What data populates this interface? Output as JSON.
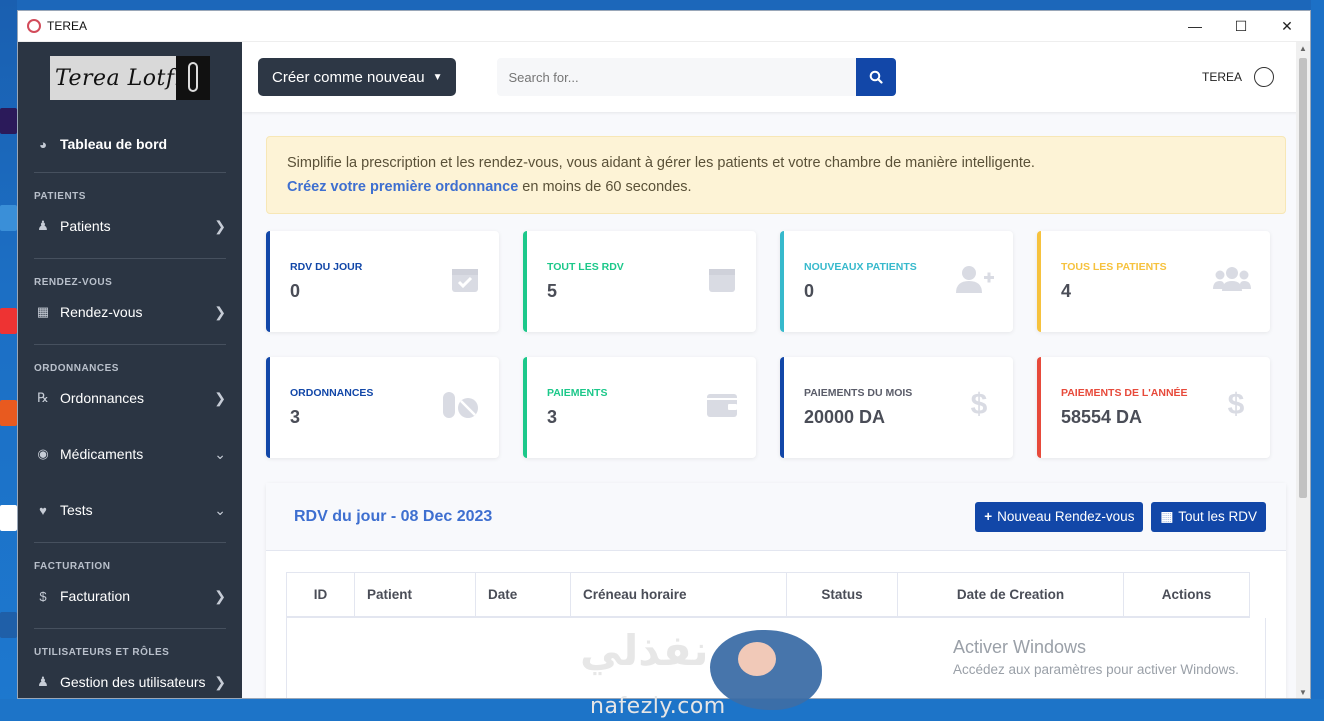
{
  "window": {
    "title": "TEREA",
    "controls": [
      "minimize",
      "maximize",
      "close"
    ]
  },
  "sidebar": {
    "logo_text": "Terea Lotfi",
    "dashboard": {
      "label": "Tableau de bord",
      "icon": "tachometer-icon"
    },
    "sections": [
      {
        "title": "PATIENTS",
        "items": [
          {
            "label": "Patients",
            "icon": "user-icon"
          }
        ]
      },
      {
        "title": "RENDEZ-VOUS",
        "items": [
          {
            "label": "Rendez-vous",
            "icon": "calendar-icon"
          }
        ]
      },
      {
        "title": "ORDONNANCES",
        "items": [
          {
            "label": "Ordonnances",
            "icon": "prescription-icon"
          },
          {
            "label": "Médicaments",
            "icon": "pills-icon"
          },
          {
            "label": "Tests",
            "icon": "heart-icon"
          }
        ]
      },
      {
        "title": "FACTURATION",
        "items": [
          {
            "label": "Facturation",
            "icon": "dollar-icon"
          }
        ]
      },
      {
        "title": "UTILISATEURS ET RÔLES",
        "items": [
          {
            "label": "Gestion des utilisateurs",
            "icon": "users-icon"
          }
        ]
      }
    ]
  },
  "topbar": {
    "create_label": "Créer comme nouveau",
    "search_placeholder": "Search for...",
    "user_name": "TEREA"
  },
  "alert": {
    "line1": "Simplifie la prescription et les rendez-vous, vous aidant à gérer les patients et votre chambre de manière intelligente.",
    "link": "Créez votre première ordonnance",
    "line2_rest": " en moins de 60 secondes."
  },
  "cards": [
    {
      "label": "RDV DU JOUR",
      "value": "0",
      "color": "#1247a8",
      "icon": "calendar-check-icon"
    },
    {
      "label": "TOUT LES RDV",
      "value": "5",
      "color": "#1cc88a",
      "icon": "calendar-icon"
    },
    {
      "label": "NOUVEAUX PATIENTS",
      "value": "0",
      "color": "#36b9cc",
      "icon": "user-plus-icon"
    },
    {
      "label": "TOUS LES PATIENTS",
      "value": "4",
      "color": "#f6c23e",
      "icon": "users-icon"
    },
    {
      "label": "ORDONNANCES",
      "value": "3",
      "color": "#1247a8",
      "icon": "pills-icon"
    },
    {
      "label": "PAIEMENTS",
      "value": "3",
      "color": "#1cc88a",
      "icon": "wallet-icon"
    },
    {
      "label": "PAIEMENTS DU MOIS",
      "value": "20000 DA",
      "color": "#1247a8",
      "label_color": "#5a5c69",
      "icon": "dollar-icon"
    },
    {
      "label": "PAIEMENTS DE L'ANNÉE",
      "value": "58554 DA",
      "color": "#e74a3b",
      "icon": "dollar-icon"
    }
  ],
  "panel": {
    "title": "RDV du jour - 08 Dec 2023",
    "new_button": "Nouveau Rendez-vous",
    "all_button": "Tout les RDV",
    "columns": [
      "ID",
      "Patient",
      "Date",
      "Créneau horaire",
      "Status",
      "Date de Creation",
      "Actions"
    ]
  },
  "watermark": {
    "title": "Activer Windows",
    "subtitle": "Accédez aux paramètres pour activer Windows."
  },
  "overlay": {
    "arabic": "نفذلي",
    "latin": "nafezly.com"
  }
}
